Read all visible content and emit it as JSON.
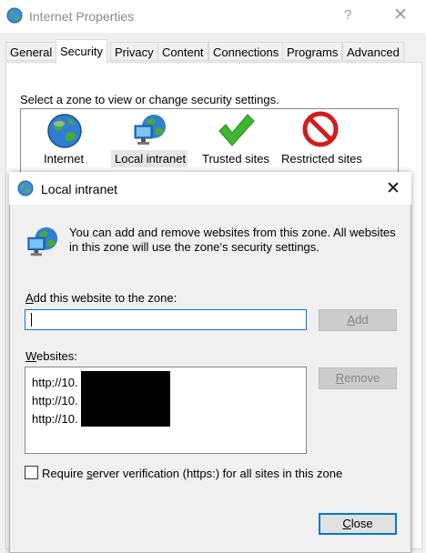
{
  "background_window": {
    "title": "Internet Properties",
    "help_glyph": "?",
    "close_glyph": "✕",
    "tabs": [
      "General",
      "Security",
      "Privacy",
      "Content",
      "Connections",
      "Programs",
      "Advanced"
    ],
    "active_tab": "Security",
    "zone_prompt": "Select a zone to view or change security settings.",
    "zones": [
      {
        "label": "Internet",
        "icon": "globe-icon"
      },
      {
        "label": "Local intranet",
        "icon": "intranet-icon"
      },
      {
        "label": "Trusted sites",
        "icon": "checkmark-icon"
      },
      {
        "label": "Restricted sites",
        "icon": "restricted-icon"
      }
    ],
    "selected_zone": "Local intranet"
  },
  "dialog": {
    "title": "Local intranet",
    "close_glyph": "✕",
    "info_text": "You can add and remove websites from this zone. All websites in this zone will use the zone's security settings.",
    "add_label_accel": "A",
    "add_label_rest": "dd this website to the zone:",
    "add_input_value": "",
    "add_button_accel": "A",
    "add_button_rest": "dd",
    "websites_label_accel": "W",
    "websites_label_rest": "ebsites:",
    "websites": [
      "http://10.",
      "http://10.",
      "http://10."
    ],
    "remove_button_accel": "R",
    "remove_button_rest": "emove",
    "verify_label_pre": "Require ",
    "verify_label_accel": "s",
    "verify_label_post": "erver verification (https:) for all sites in this zone",
    "verify_checked": false,
    "close_button_accel": "C",
    "close_button_rest": "lose"
  },
  "colors": {
    "focus_blue": "#0078d7",
    "dialog_bg": "#f0f0f0",
    "disabled_text": "#838383"
  }
}
